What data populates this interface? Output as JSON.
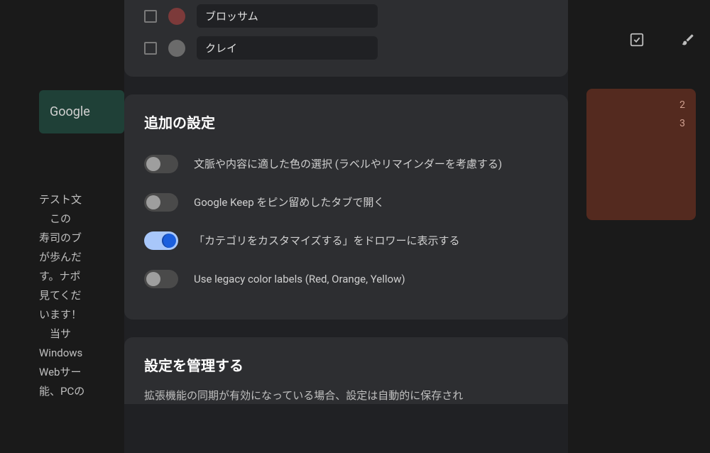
{
  "background": {
    "card1_text": "Google",
    "card2_lines": [
      "テスト文",
      "",
      "　この",
      "寿司のブ",
      "が歩んだ",
      "す。ナポ",
      "見てくだ",
      "います！",
      "",
      "　当サ",
      "Windows",
      "Webサー",
      "能、PCの"
    ],
    "right_numbers": [
      "2",
      "3"
    ]
  },
  "colors_section": {
    "items": [
      {
        "label": "ブロッサム",
        "swatch": "#7c3a3a"
      },
      {
        "label": "クレイ",
        "swatch": "#6b6b6b"
      }
    ]
  },
  "additional_settings": {
    "title": "追加の設定",
    "toggles": [
      {
        "label": "文脈や内容に適した色の選択 (ラベルやリマインダーを考慮する)",
        "on": false
      },
      {
        "label": "Google Keep をピン留めしたタブで開く",
        "on": false
      },
      {
        "label": "「カテゴリをカスタマイズする」をドロワーに表示する",
        "on": true
      },
      {
        "label": "Use legacy color labels (Red, Orange, Yellow)",
        "on": false
      }
    ]
  },
  "manage_settings": {
    "title": "設定を管理する",
    "subtitle": "拡張機能の同期が有効になっている場合、設定は自動的に保存され"
  }
}
